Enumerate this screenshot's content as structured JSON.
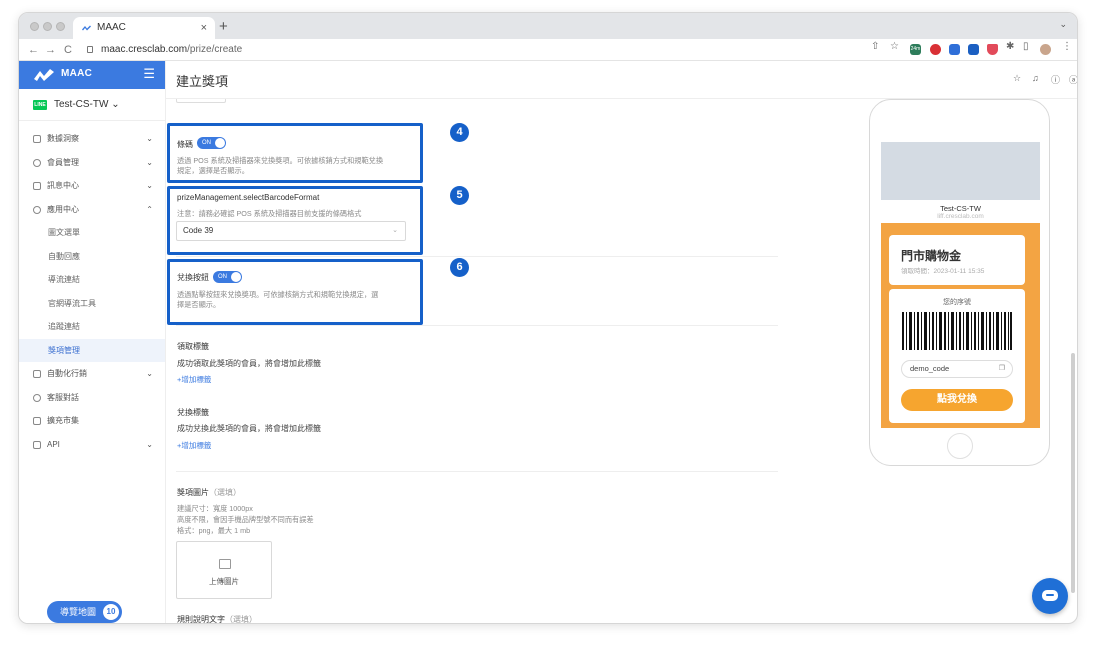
{
  "browser": {
    "tab_title": "MAAC",
    "tab_close": "×",
    "new_tab": "+",
    "tab_menu": "⌄",
    "url_host": "maac.cresclab.com",
    "url_path": "/prize/create",
    "nav": {
      "back": "←",
      "forward": "→",
      "reload": "C"
    },
    "ext_badge": "24m"
  },
  "sidebar": {
    "brand": "MAAC",
    "menu_icon": "☰",
    "account": {
      "line_badge": "LINE",
      "name": "Test-CS-TW",
      "caret": "⌄"
    },
    "items": [
      {
        "label": "數據洞察",
        "icon": "chart-icon",
        "chevron": "⌄"
      },
      {
        "label": "會員管理",
        "icon": "user-icon",
        "chevron": "⌄"
      },
      {
        "label": "訊息中心",
        "icon": "send-icon",
        "chevron": "⌄"
      },
      {
        "label": "應用中心",
        "icon": "apps-icon",
        "chevron": "⌃"
      },
      {
        "label": "圖文選單",
        "sub": true
      },
      {
        "label": "自動回應",
        "sub": true
      },
      {
        "label": "導流連結",
        "sub": true
      },
      {
        "label": "官網導流工具",
        "sub": true
      },
      {
        "label": "追蹤連結",
        "sub": true
      },
      {
        "label": "獎項管理",
        "sub": true,
        "active": true
      },
      {
        "label": "自動化行銷",
        "icon": "automation-icon",
        "chevron": "⌄"
      },
      {
        "label": "客服對話",
        "icon": "chat-icon"
      },
      {
        "label": "擴充市集",
        "icon": "store-icon"
      },
      {
        "label": "API",
        "icon": "api-icon",
        "chevron": "⌄"
      }
    ],
    "guide": {
      "label": "導覽地圖",
      "badge": "10"
    }
  },
  "header": {
    "title": "建立獎項",
    "icons": [
      "star-icon",
      "bell-icon",
      "help-icon",
      "user-switch-icon"
    ]
  },
  "form": {
    "barcode": {
      "label": "條碼",
      "toggle": "ON",
      "desc_line1": "透過 POS 系統及掃描器來兌換獎項。可依據核銷方式和規範兌換",
      "desc_line2": "規定，選擇是否顯示。"
    },
    "format": {
      "label": "prizeManagement.selectBarcodeFormat",
      "note": "注意：請務必確認 POS 系統及掃描器目前支援的條碼格式",
      "value": "Code 39",
      "caret": "⌄"
    },
    "redeem_button": {
      "label": "兌換按鈕",
      "toggle": "ON",
      "desc_line1": "透過點擊按鈕來兌換獎項。可依據核銷方式和規範兌換規定，選",
      "desc_line2": "擇是否顯示。"
    },
    "claim_tag": {
      "label": "領取標籤",
      "desc": "成功領取此獎項的會員，將會增加此標籤",
      "add": "+增加標籤"
    },
    "redeem_tag": {
      "label": "兌換標籤",
      "desc": "成功兌換此獎項的會員，將會增加此標籤",
      "add": "+增加標籤"
    },
    "prize_image": {
      "label": "獎項圖片",
      "optional": "（選填）",
      "desc_line1": "建議尺寸：寬度 1000px",
      "desc_line2": "高度不限，會因手機品牌型號不同而有誤差",
      "desc_line3": "格式：png，最大 1 mb",
      "upload": "上傳圖片"
    },
    "rules": {
      "label": "規則說明文字",
      "optional": "（選填）"
    }
  },
  "callouts": [
    "4",
    "5",
    "6"
  ],
  "preview": {
    "shop_name": "Test-CS-TW",
    "site": "liff.cresclab.com",
    "coupon_title": "門市購物金",
    "coupon_date": "領取時間：2023-01-11 15:35",
    "serial_label": "您的序號",
    "code": "demo_code",
    "redeem": "點我兌換"
  },
  "colors": {
    "accent": "#3b7ae0",
    "callout": "#1560c9",
    "coupon": "#f3a443",
    "redeem": "#f6a52f"
  }
}
